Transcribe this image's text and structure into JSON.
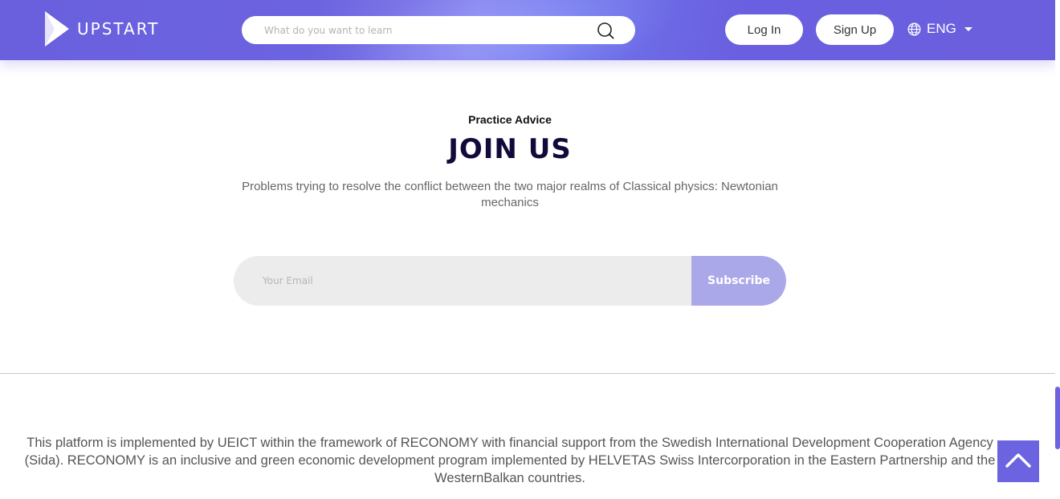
{
  "header": {
    "brand": "UPSTART",
    "search": {
      "placeholder": "What do you want to learn",
      "value": ""
    },
    "login_label": "Log In",
    "signup_label": "Sign Up",
    "language": "ENG"
  },
  "join": {
    "eyebrow": "Practice Advice",
    "title": "JOIN US",
    "description": "Problems trying to resolve the conflict between the two major realms of Classical physics: Newtonian mechanics",
    "email": {
      "placeholder": "Your Email",
      "value": ""
    },
    "subscribe_label": "Subscribe"
  },
  "footer": {
    "text": "This platform is implemented by UEICT within the framework of RECONOMY with financial support from the Swedish International Development Cooperation Agency (Sida). RECONOMY is an inclusive and green economic development program implemented by HELVETAS Swiss Intercorporation in the Eastern Partnership and the WesternBalkan countries."
  },
  "icons": {
    "logo": "play-logo-icon",
    "search": "search-icon",
    "language": "globe-icon",
    "language_caret": "caret-down-icon",
    "scroll_top": "chevron-up-icon"
  },
  "colors": {
    "brand_purple": "#6c63e0",
    "subscribe_button": "#aba8ea",
    "headline": "#120a3a"
  }
}
